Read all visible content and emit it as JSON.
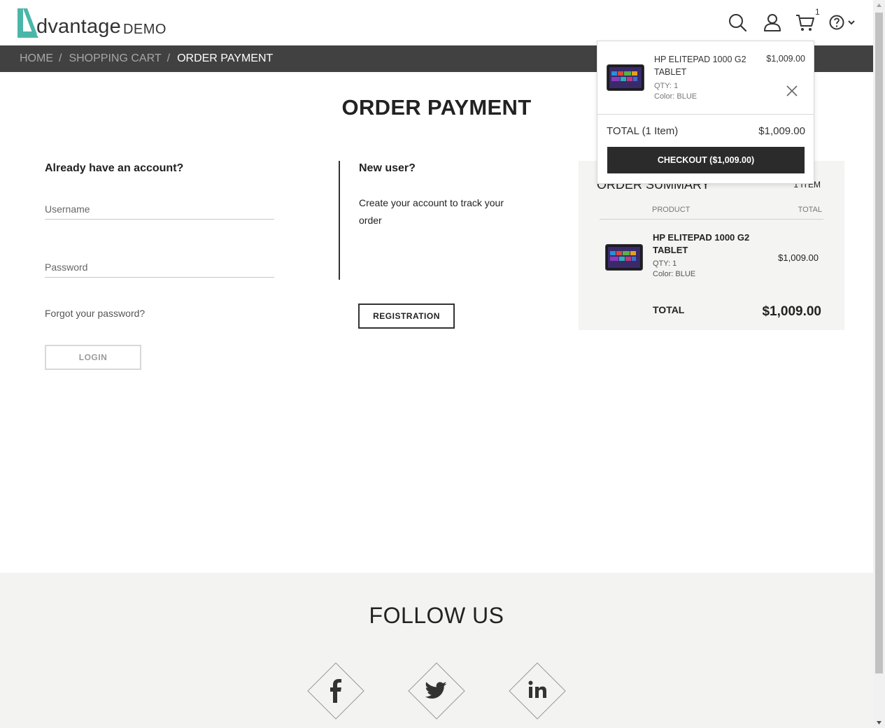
{
  "header": {
    "logo_word": "dvantage",
    "logo_demo": "DEMO",
    "cart_count": "1",
    "icons": [
      "search-icon",
      "user-icon",
      "cart-icon",
      "help-icon",
      "chevron-down-icon"
    ]
  },
  "breadcrumb": {
    "items": [
      "HOME",
      "SHOPPING CART"
    ],
    "separator": "/",
    "current": "ORDER PAYMENT"
  },
  "page": {
    "title": "ORDER PAYMENT"
  },
  "login": {
    "heading": "Already have an account?",
    "username_placeholder": "Username",
    "password_placeholder": "Password",
    "forgot": "Forgot your password?",
    "login_label": "LOGIN"
  },
  "new_user": {
    "heading": "New user?",
    "text": "Create your account to track your order",
    "register_label": "REGISTRATION"
  },
  "summary": {
    "title": "ORDER SUMMARY",
    "count": "1 ITEM",
    "col_product": "PRODUCT",
    "col_total": "TOTAL",
    "item": {
      "name": "HP ELITEPAD 1000 G2 TABLET",
      "qty": "QTY: 1",
      "color": "Color: BLUE",
      "price": "$1,009.00"
    },
    "total_label": "TOTAL",
    "total_value": "$1,009.00"
  },
  "cart_popup": {
    "item": {
      "name": "HP ELITEPAD 1000 G2 TABLET",
      "qty": "QTY: 1",
      "color": "Color: BLUE",
      "price": "$1,009.00"
    },
    "total_label": "TOTAL (1 Item)",
    "total_value": "$1,009.00",
    "checkout_label": "CHECKOUT ($1,009.00)"
  },
  "footer": {
    "follow": "FOLLOW US",
    "social": [
      "facebook-icon",
      "twitter-icon",
      "linkedin-icon"
    ]
  },
  "colors": {
    "accent": "#4ab6a8",
    "breadcrumb_bg": "#414141",
    "summary_bg": "#f4f4f2",
    "footer_bg": "#f3f3f2",
    "checkout_bg": "#2b2b2b"
  }
}
